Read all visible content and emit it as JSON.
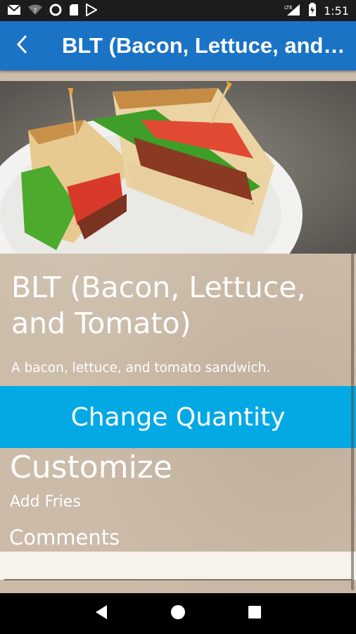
{
  "status_bar": {
    "time": "1:51",
    "network": "LTE",
    "icons_left": [
      "mail-icon",
      "wifi-question-icon",
      "circle-icon",
      "sd-card-icon",
      "play-store-icon"
    ],
    "icons_right": [
      "signal-icon",
      "battery-icon"
    ]
  },
  "app_bar": {
    "back_icon": "chevron-left-icon",
    "title": "BLT (Bacon, Lettuce, and Tomato)",
    "accent_color": "#1a73c4"
  },
  "item": {
    "image_alt": "BLT sandwich on a white plate",
    "name": "BLT (Bacon, Lettuce, and Tomato)",
    "description": "A bacon, lettuce, and tomato sandwich."
  },
  "actions": {
    "change_quantity_label": "Change Quantity",
    "button_color": "#03a9e4"
  },
  "customize": {
    "heading": "Customize",
    "options": [
      "Add Fries"
    ]
  },
  "comments": {
    "label": "Comments",
    "value": "",
    "placeholder": ""
  },
  "nav_bar": {
    "buttons": [
      "back-triangle-icon",
      "home-circle-icon",
      "recents-square-icon"
    ]
  }
}
